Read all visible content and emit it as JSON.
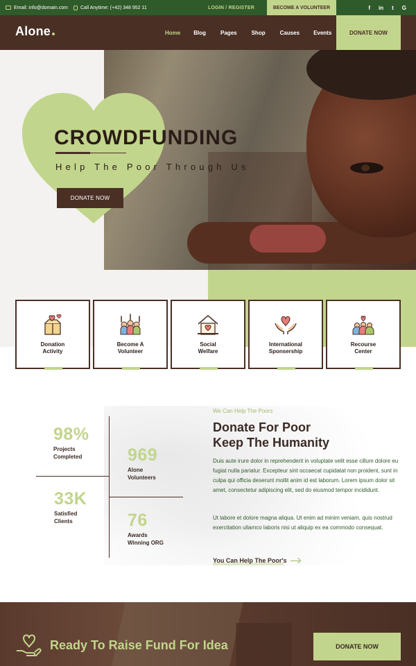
{
  "topbar": {
    "email": "Email: info@domain.com",
    "call": "Call Anytime: (+42) 348 952 11",
    "login": "LOGIN / REGISTER",
    "volunteer": "BECOME A VOLUNTEER",
    "socials": [
      "f",
      "in",
      "t",
      "G"
    ]
  },
  "header": {
    "logo": "Alone",
    "nav": [
      "Home",
      "Blog",
      "Pages",
      "Shop",
      "Causes",
      "Events"
    ],
    "donate": "DONATE NOW"
  },
  "hero": {
    "title": "CROWDFUNDING",
    "subtitle": "Help The Poor Through Us",
    "button": "DONATE NOW"
  },
  "features": [
    {
      "line1": "Donation",
      "line2": "Activity",
      "icon": "donation-box-icon"
    },
    {
      "line1": "Become A",
      "line2": "Volunteer",
      "icon": "raised-hands-icon"
    },
    {
      "line1": "Social",
      "line2": "Welfare",
      "icon": "house-heart-icon"
    },
    {
      "line1": "International",
      "line2": "Sponsership",
      "icon": "hands-heart-icon"
    },
    {
      "line1": "Recourse",
      "line2": "Center",
      "icon": "people-group-icon"
    }
  ],
  "stats": [
    {
      "num": "98%",
      "l1": "Projects",
      "l2": "Completed"
    },
    {
      "num": "969",
      "l1": "Alone",
      "l2": "Volunteers"
    },
    {
      "num": "33K",
      "l1": "Satisfied",
      "l2": "Clients"
    },
    {
      "num": "76",
      "l1": "Awards",
      "l2": "Winning ORG"
    }
  ],
  "about": {
    "eyebrow": "We Can Help The Poors",
    "title1": "Donate For Poor",
    "title2": "Keep The Humanity",
    "p1": "Duis aute irure dolor in reprehenderit in voluptate velit esse cillum dolore eu fugiat nulla pariatur. Excepteur sint occaecat cupidatat non proident, sunt in culpa qui officia deserunt mollit anim id est laborum. Lorem ipsum dolor sit amet, consectetur adipiscing elit, sed do eiusmod tempor incididunt.",
    "p2": "Ut labore et dolore magna aliqua. Ut enim ad minim veniam, quis nostrud exercitation ullamco laboris nisi ut aliquip ex ea commodo consequat.",
    "link": "You Can Help The Poor's"
  },
  "cta": {
    "title": "Ready To Raise Fund For Idea",
    "button": "DONATE NOW"
  },
  "colors": {
    "brown": "#4a2f25",
    "green": "#c2d58c",
    "darkgreen": "#2f5a2a"
  }
}
